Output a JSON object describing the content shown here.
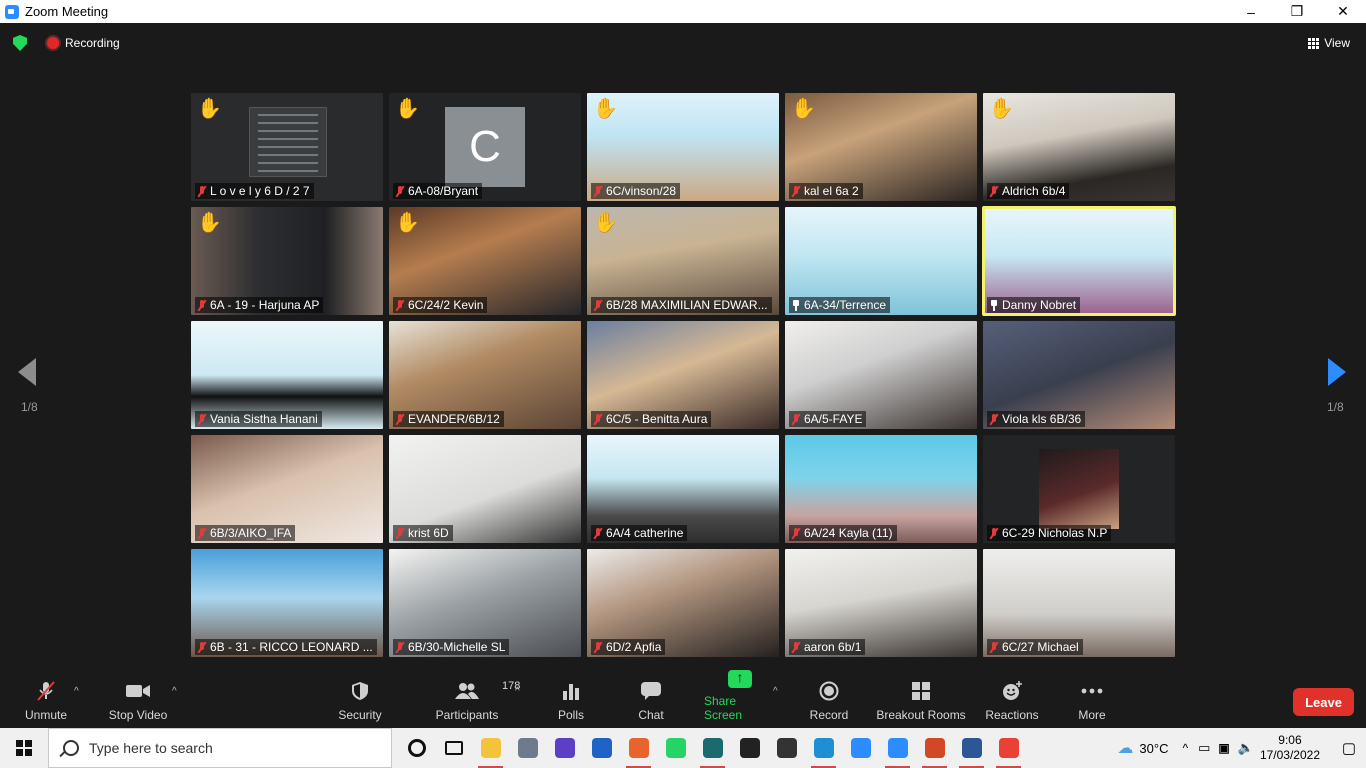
{
  "window": {
    "title": "Zoom Meeting",
    "controls": [
      "–",
      "❐",
      "✕"
    ]
  },
  "meeting": {
    "recording_label": "Recording",
    "view_label": "View"
  },
  "tiles": [
    {
      "name": "L o v e l y 6 D / 2 7",
      "hand": true,
      "bg": "#2a2b2d",
      "kind": "doc",
      "icon": "mic"
    },
    {
      "name": "6A-08/Bryant",
      "hand": true,
      "bg": "#232425",
      "kind": "avatar",
      "avatar_letter": "C",
      "icon": "mic"
    },
    {
      "name": "6C/vinson/28",
      "hand": true,
      "bg": "linear-gradient(180deg,#dff2fa 0%,#bfe4f3 40%,#caa985 100%)",
      "kind": "video",
      "icon": "mic"
    },
    {
      "name": "kal el 6a 2",
      "hand": true,
      "bg": "linear-gradient(160deg,#7a5a3e 0%,#c7a27a 40%,#2b2422 100%)",
      "kind": "video",
      "icon": "mic"
    },
    {
      "name": "Aldrich 6b/4",
      "hand": true,
      "bg": "linear-gradient(170deg,#e8e6e0 0%,#cfc8bd 40%,#2a2724 75%,#3a3532 100%)",
      "kind": "video",
      "icon": "mic"
    },
    {
      "name": "6A - 19 - Harjuna AP",
      "hand": true,
      "bg": "linear-gradient(90deg,#6a5a52 0%,#2d2e31 35%,#1f2023 70%,#8a7a70 100%)",
      "kind": "video",
      "icon": "mic"
    },
    {
      "name": "6C/24/2 Kevin",
      "hand": true,
      "bg": "linear-gradient(160deg,#5c3a26 0%,#b57d4f 40%,#26262a 100%)",
      "kind": "video",
      "icon": "mic"
    },
    {
      "name": "6B/28 MAXIMILIAN EDWAR...",
      "hand": true,
      "hand_light": true,
      "bg": "linear-gradient(170deg,#bdb6ad 0%,#c8b493 40%,#5a4a3e 100%)",
      "kind": "video",
      "icon": "mic"
    },
    {
      "name": "6A-34/Terrence",
      "hand": false,
      "bg": "linear-gradient(180deg,#e6f5fb 0%,#c1e6f2 45%,#7fc3d9 100%)",
      "kind": "video",
      "icon": "pin"
    },
    {
      "name": "Danny Nobret",
      "hand": false,
      "bg": "linear-gradient(180deg,#eaf6fb 0%,#c7e8f4 45%,#9b5f8c 100%)",
      "kind": "video",
      "icon": "pin",
      "active": true
    },
    {
      "name": "Vania Sistha Hanani",
      "hand": false,
      "bg": "linear-gradient(180deg,#ecf7fb 0%,#cde9f3 50%,#111111 70%,#d7ecf2 100%)",
      "kind": "video",
      "icon": "mic"
    },
    {
      "name": "EVANDER/6B/12",
      "hand": false,
      "bg": "linear-gradient(160deg,#e8e2d6 0%,#b08a62 40%,#5c4536 100%)",
      "kind": "video",
      "icon": "mic"
    },
    {
      "name": "6C/5 - Benitta Aura",
      "hand": false,
      "bg": "linear-gradient(160deg,#6a7fa0 0%,#d6b894 45%,#3a2c28 100%)",
      "kind": "video",
      "icon": "mic"
    },
    {
      "name": "6A/5-FAYE",
      "hand": false,
      "bg": "linear-gradient(160deg,#f0efed 0%,#cfcfcf 40%,#3b3330 100%)",
      "kind": "video",
      "icon": "mic"
    },
    {
      "name": "Viola kls 6B/36",
      "hand": false,
      "bg": "linear-gradient(160deg,#55607a 0%,#3a3f4e 50%,#b48c78 100%)",
      "kind": "video",
      "icon": "mic"
    },
    {
      "name": "6B/3/AIKO_IFA",
      "hand": false,
      "bg": "linear-gradient(160deg,#7a5a4c 0%,#d9c1ad 45%,#f0e8e2 100%)",
      "kind": "video",
      "icon": "mic"
    },
    {
      "name": "krist 6D",
      "hand": false,
      "bg": "linear-gradient(160deg,#f2f2f0 0%,#dcdcda 55%,#343434 100%)",
      "kind": "video",
      "icon": "mic"
    },
    {
      "name": "6A/4 catherine",
      "hand": false,
      "bg": "linear-gradient(180deg,#e9f6fb 0%,#c5e6f1 40%,#4a4a4a 75%,#2d2d2d 100%)",
      "kind": "video",
      "icon": "mic"
    },
    {
      "name": "6A/24 Kayla (11)",
      "hand": false,
      "bg": "linear-gradient(180deg,#5cc9e8 0%,#7fd3ea 40%,#c7a3a0 75%,#7c5b58 100%)",
      "kind": "video",
      "icon": "mic"
    },
    {
      "name": "6C-29 Nicholas N.P",
      "hand": false,
      "bg": "#232425",
      "kind": "profile",
      "icon": "mic"
    },
    {
      "name": "6B - 31 - RICCO LEONARD ...",
      "hand": false,
      "bg": "linear-gradient(180deg,#4a9fd9 0%,#a9d6ef 45%,#6a5648 100%)",
      "kind": "video",
      "icon": "mic"
    },
    {
      "name": "6B/30-Michelle SL",
      "hand": false,
      "bg": "linear-gradient(160deg,#f4f4f2 0%,#9aa0a4 45%,#4b4e52 100%)",
      "kind": "video",
      "icon": "mic"
    },
    {
      "name": "6D/2 Apfia",
      "hand": false,
      "bg": "linear-gradient(160deg,#ecebea 0%,#b39680 40%,#25211f 100%)",
      "kind": "video",
      "icon": "mic"
    },
    {
      "name": "aaron 6b/1",
      "hand": false,
      "bg": "linear-gradient(170deg,#f2f1ee 0%,#d7d5d0 45%,#3a3431 100%)",
      "kind": "video",
      "icon": "mic"
    },
    {
      "name": "6C/27 Michael",
      "hand": false,
      "bg": "linear-gradient(180deg,#eeeeec 0%,#d0ceca 60%,#7a6a62 100%)",
      "kind": "video",
      "icon": "mic"
    }
  ],
  "pagination": {
    "left": "1/8",
    "right": "1/8"
  },
  "toolbar": {
    "unmute": "Unmute",
    "stop_video": "Stop Video",
    "security": "Security",
    "participants": "Participants",
    "participants_count": "178",
    "polls": "Polls",
    "chat": "Chat",
    "share_screen": "Share Screen",
    "record": "Record",
    "breakout_rooms": "Breakout Rooms",
    "reactions": "Reactions",
    "more": "More",
    "leave": "Leave",
    "accent_green": "#23d959",
    "leave_red": "#e0322b"
  },
  "taskbar": {
    "search_placeholder": "Type here to search",
    "temperature": "30°C",
    "time": "9:06",
    "date": "17/03/2022",
    "apps": [
      {
        "icon": "cortana-icon",
        "color": "#111111",
        "open": false
      },
      {
        "icon": "task-view-icon",
        "color": "#111111",
        "open": false
      },
      {
        "icon": "file-explorer-icon",
        "color": "#f3c33c",
        "open": true
      },
      {
        "icon": "photos-icon",
        "color": "#6d7b8c",
        "open": false
      },
      {
        "icon": "headset-app-icon",
        "color": "#5b3fc4",
        "open": false
      },
      {
        "icon": "app-blue-cross-icon",
        "color": "#1f63c7",
        "open": false
      },
      {
        "icon": "firefox-icon",
        "color": "#e8642c",
        "open": true
      },
      {
        "icon": "whatsapp-icon",
        "color": "#25d366",
        "open": false
      },
      {
        "icon": "media-app-icon",
        "color": "#1b6b6e",
        "open": true
      },
      {
        "icon": "camera-app-icon",
        "color": "#222222",
        "open": false
      },
      {
        "icon": "settings-icon",
        "color": "#333333",
        "open": false
      },
      {
        "icon": "edge-icon",
        "color": "#1f8fd4",
        "open": true
      },
      {
        "icon": "zoom-icon",
        "color": "#2d8cff",
        "open": false
      },
      {
        "icon": "zoom-meeting-icon",
        "color": "#2d8cff",
        "open": true
      },
      {
        "icon": "powerpoint-icon",
        "color": "#d24726",
        "open": true
      },
      {
        "icon": "word-icon",
        "color": "#2b5797",
        "open": true
      },
      {
        "icon": "chrome-icon",
        "color": "#e94235",
        "open": true
      }
    ]
  }
}
